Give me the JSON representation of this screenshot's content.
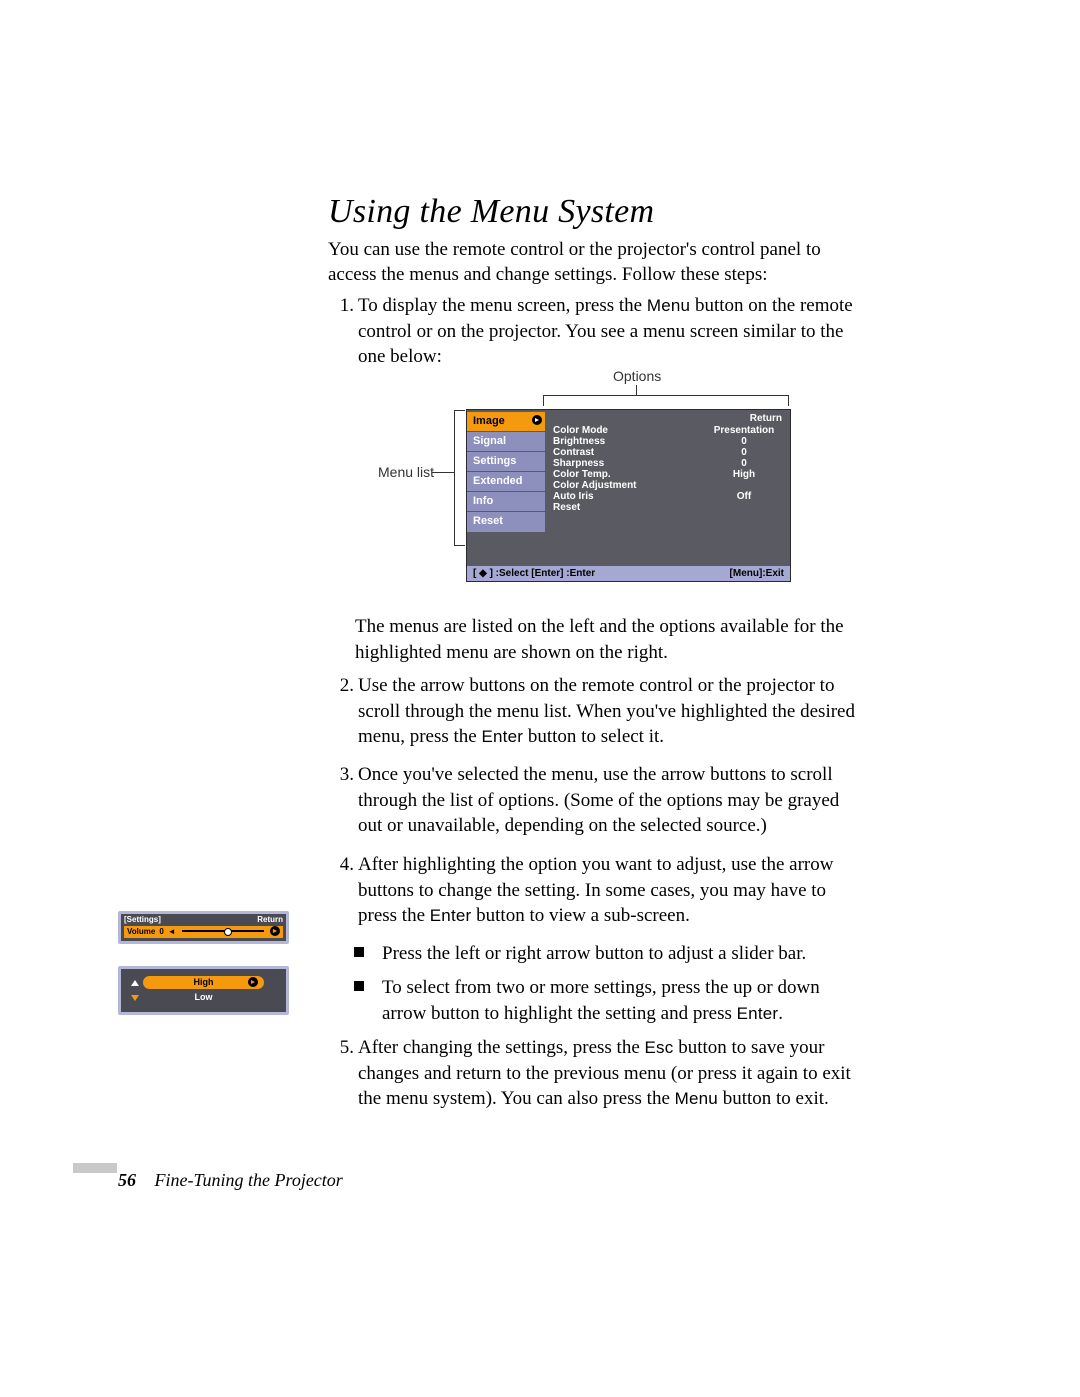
{
  "heading": "Using the Menu System",
  "intro": "You can use the remote control or the projector's control panel to access the menus and change settings. Follow these steps:",
  "steps": {
    "s1": {
      "num": "1.",
      "a": "To display the menu screen, press the ",
      "b": "Menu",
      "c": " button on the remote control or on the projector. You see a menu screen similar to the one below:"
    },
    "after_img": "The menus are listed on the left and the options available for the highlighted menu are shown on the right.",
    "s2": {
      "num": "2.",
      "a": "Use the arrow buttons on the remote control or the projector to scroll through the menu list. When you've highlighted the desired menu, press the ",
      "b": "Enter",
      "c": " button to select it."
    },
    "s3": {
      "num": "3.",
      "text": "Once you've selected the menu, use the arrow buttons to scroll through the list of options. (Some of the options may be grayed out or unavailable, depending on the selected source.)"
    },
    "s4": {
      "num": "4.",
      "a": "After highlighting the option you want to adjust, use the arrow buttons to change the setting. In some cases, you may have to press the ",
      "b": "Enter",
      "c": " button to view a sub-screen."
    },
    "b1": "Press the left or right arrow button to adjust a slider bar.",
    "b2": {
      "a": "To select from two or more settings, press the up or down arrow button to highlight the setting and press ",
      "b": "Enter",
      "c": "."
    },
    "s5": {
      "num": "5.",
      "a": "After changing the settings, press the ",
      "b": "Esc",
      "c": " button to save your changes and return to the previous menu (or press it again to exit the menu system). You can also press the ",
      "d": "Menu",
      "e": " button to exit."
    }
  },
  "labels": {
    "options": "Options",
    "menu_list": "Menu list"
  },
  "osd": {
    "left": {
      "i0": "Image",
      "i1": "Signal",
      "i2": "Settings",
      "i3": "Extended",
      "i4": "Info",
      "i5": "Reset"
    },
    "right": {
      "return": "Return",
      "r0k": "Color Mode",
      "r0v": "Presentation",
      "r1k": "Brightness",
      "r1v": "0",
      "r2k": "Contrast",
      "r2v": "0",
      "r3k": "Sharpness",
      "r3v": "0",
      "r4k": "Color Temp.",
      "r4v": "High",
      "r5k": "Color Adjustment",
      "r5v": "",
      "r6k": "Auto Iris",
      "r6v": "Off",
      "r7k": "Reset",
      "r7v": ""
    },
    "bar": {
      "left": "[ ◆ ] :Select  [Enter] :Enter",
      "right": "[Menu]:Exit"
    }
  },
  "side1": {
    "hdr_left": "[Settings]",
    "hdr_right": "Return",
    "volume_label": "Volume",
    "volume_value": "0"
  },
  "side2": {
    "opt_high": "High",
    "opt_low": "Low"
  },
  "footer": {
    "page": "56",
    "chapter": "Fine-Tuning the Projector"
  }
}
